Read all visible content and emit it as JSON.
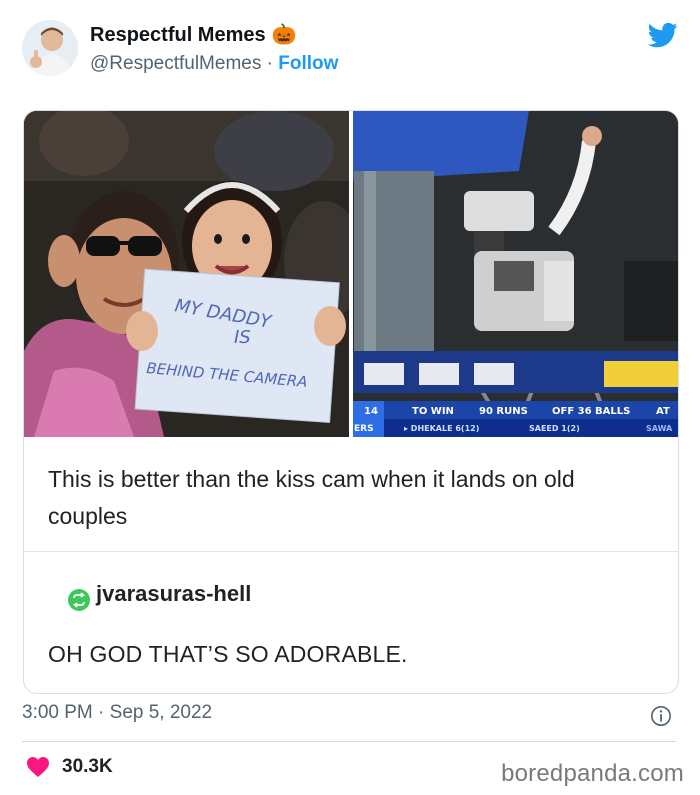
{
  "header": {
    "display_name": "Respectful Memes",
    "name_emoji": "🎃",
    "handle": "@RespectfulMemes",
    "separator": "·",
    "follow_label": "Follow"
  },
  "photo": {
    "sign_lines": [
      "MY DADDY",
      "IS",
      "BEHIND THE CAMERA"
    ],
    "scoreboard": {
      "left_top": "14",
      "left_bottom": "ERS",
      "to_win_label": "TO WIN",
      "runs": "90 RUNS",
      "balls": "OFF 36 BALLS",
      "at": "AT",
      "batsman1": "▸ DHEKALE 6(12)",
      "batsman2": "SAEED 1(2)",
      "right_bottom": "SAWA"
    }
  },
  "post": {
    "text": "This is better than the kiss cam when it lands on old couples",
    "reply_user": "jvarasuras-hell",
    "reply_text": "OH GOD THAT’S SO ADORABLE."
  },
  "meta": {
    "timestamp": "3:00 PM · Sep 5, 2022",
    "likes": "30.3K",
    "watermark": "boredpanda.com"
  },
  "colors": {
    "twitter_blue": "#1d9bf0",
    "heart": "#f91880",
    "reblog_green": "#3ec85b"
  },
  "icons": [
    "twitter-bird-icon",
    "info-icon",
    "heart-icon",
    "reblog-icon"
  ]
}
